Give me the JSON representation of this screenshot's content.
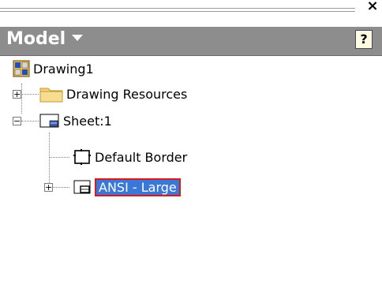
{
  "window": {
    "close_glyph": "×"
  },
  "panel": {
    "title": "Model",
    "help_glyph": "?"
  },
  "tree": {
    "root": {
      "label": "Drawing1",
      "icon": "drawing-icon"
    },
    "items": [
      {
        "label": "Drawing Resources",
        "icon": "folder-icon",
        "expander": "+"
      },
      {
        "label": "Sheet:1",
        "icon": "sheet-icon",
        "expander": "−"
      },
      {
        "label": "Default Border",
        "icon": "border-icon"
      },
      {
        "label": "ANSI - Large",
        "icon": "title-block-icon",
        "expander": "+",
        "selected": true
      }
    ]
  },
  "colors": {
    "header_bg": "#8d8d8d",
    "selection_bg": "#3a78d8",
    "selection_border": "#d81a1a"
  }
}
